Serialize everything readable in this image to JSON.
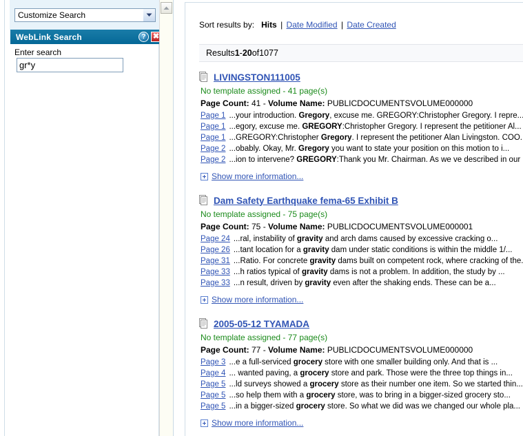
{
  "left_panel": {
    "customize_select": {
      "value": "Customize Search",
      "icon": "chevron-down-icon"
    },
    "panel_header": {
      "title": "WebLink Search",
      "help_icon": "?",
      "close_icon": "✖"
    },
    "search": {
      "label": "Enter search",
      "value": "gr*y",
      "placeholder": ""
    },
    "scrollbar": {
      "up_icon": "chevron-up-icon"
    }
  },
  "right_panel": {
    "sort": {
      "label": "Sort results by:",
      "active": "Hits",
      "separator": "|",
      "options": [
        "Date Modified",
        "Date Created"
      ]
    },
    "results_bar": {
      "prefix": "Results ",
      "from": "1",
      "dash": " - ",
      "to": "20",
      "of": " of ",
      "total": "1077"
    },
    "show_more_label": "Show more information...",
    "results": [
      {
        "title": "LIVINGSTON111005",
        "template": "No template assigned - 41 page(s)",
        "page_count_label": "Page Count:",
        "page_count": "41",
        "volume_label": "Volume Name:",
        "volume": "PUBLICDOCUMENTSVOLUME000000",
        "snippets": [
          {
            "page": "Page 1",
            "pre": "...your introduction. ",
            "hl": "Gregory",
            "post": ", excuse me. GREGORY:Christopher Gregory. I repre..."
          },
          {
            "page": "Page 1",
            "pre": "...egory, excuse me. ",
            "hl": "GREGORY",
            "post": ":Christopher Gregory. I represent the petitioner Al..."
          },
          {
            "page": "Page 1",
            "pre": "...GREGORY:Christopher ",
            "hl": "Gregory",
            "post": ". I represent the petitioner Alan Livingston. COO..."
          },
          {
            "page": "Page 2",
            "pre": "...obably. Okay, Mr. ",
            "hl": "Gregory",
            "post": " you want to state your position on this motion to i..."
          },
          {
            "page": "Page 2",
            "pre": "...ion to intervene? ",
            "hl": "GREGORY",
            "post": ":Thank you Mr. Chairman. As we ve described in our ..."
          }
        ]
      },
      {
        "title": "Dam Safety Earthquake fema-65 Exhibit B",
        "template": "No template assigned - 75 page(s)",
        "page_count_label": "Page Count:",
        "page_count": "75",
        "volume_label": "Volume Name:",
        "volume": "PUBLICDOCUMENTSVOLUME000001",
        "snippets": [
          {
            "page": "Page 24",
            "pre": "...ral, instability of ",
            "hl": "gravity",
            "post": " and arch dams caused by excessive cracking o..."
          },
          {
            "page": "Page 26",
            "pre": "...tant location for a ",
            "hl": "gravity",
            "post": " dam under static conditions is within the middle 1/..."
          },
          {
            "page": "Page 31",
            "pre": "...Ratio. For concrete ",
            "hl": "gravity",
            "post": " dams built on competent rock, where cracking of the..."
          },
          {
            "page": "Page 33",
            "pre": "...h ratios typical of ",
            "hl": "gravity",
            "post": " dams is not a problem. In addition, the study by ..."
          },
          {
            "page": "Page 33",
            "pre": "...n result, driven by ",
            "hl": "gravity",
            "post": " even after the shaking ends. These can be a..."
          }
        ]
      },
      {
        "title": "2005-05-12 TYAMADA",
        "template": "No template assigned - 77 page(s)",
        "page_count_label": "Page Count:",
        "page_count": "77",
        "volume_label": "Volume Name:",
        "volume": "PUBLICDOCUMENTSVOLUME000000",
        "snippets": [
          {
            "page": "Page 3",
            "pre": "...e a full-serviced ",
            "hl": "grocery",
            "post": " store with one smaller building only. And that is ..."
          },
          {
            "page": "Page 4",
            "pre": "... wanted paving, a ",
            "hl": "grocery",
            "post": " store and park. Those were the three top things in..."
          },
          {
            "page": "Page 5",
            "pre": "...ld surveys showed a ",
            "hl": "grocery",
            "post": " store as their number one item. So we started thin..."
          },
          {
            "page": "Page 5",
            "pre": "...so help them with a ",
            "hl": "grocery",
            "post": " store, was to bring in a bigger-sized grocery sto..."
          },
          {
            "page": "Page 5",
            "pre": "...in a bigger-sized ",
            "hl": "grocery",
            "post": " store. So what we did was we changed our whole pla..."
          }
        ]
      }
    ]
  },
  "colors": {
    "header_teal": "#0f6f9e",
    "link_blue": "#3054b5",
    "template_green": "#1a8a1a",
    "panel_tint": "#e8f3fa",
    "results_bar_bg": "#f8f9fb"
  }
}
